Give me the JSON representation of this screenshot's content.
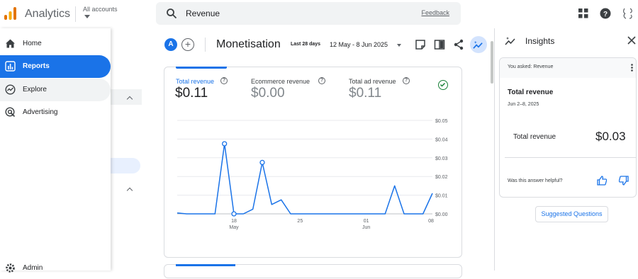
{
  "app": {
    "name": "Analytics",
    "accounts_label": "All accounts"
  },
  "search": {
    "value": "Revenue",
    "feedback": "Feedback"
  },
  "sidebar": {
    "items": [
      {
        "label": "Home",
        "icon": "home-icon"
      },
      {
        "label": "Reports",
        "icon": "bar-chart-icon"
      },
      {
        "label": "Explore",
        "icon": "explore-icon"
      },
      {
        "label": "Advertising",
        "icon": "advertising-icon"
      },
      {
        "label": "Admin",
        "icon": "gear-icon"
      }
    ]
  },
  "header": {
    "avatar": "A",
    "add": "+",
    "title": "Monetisation",
    "range_label": "Last 28 days",
    "range": "12 May - 8 Jun 2025"
  },
  "metrics": [
    {
      "label": "Total revenue",
      "value": "$0.11",
      "selected": true
    },
    {
      "label": "Ecommerce revenue",
      "value": "$0.00",
      "selected": false
    },
    {
      "label": "Total ad revenue",
      "value": "$0.11",
      "selected": false
    }
  ],
  "chart_data": {
    "type": "line",
    "x_tick_labels": [
      "18",
      "May",
      "25",
      "01",
      "Jun",
      "08"
    ],
    "y_tick_labels": [
      "$0.05",
      "$0.04",
      "$0.03",
      "$0.02",
      "$0.01",
      "$0.00"
    ],
    "ylim": [
      0,
      0.05
    ],
    "grid": true,
    "series": [
      {
        "x": [
          "12 May",
          "13 May",
          "14 May",
          "15 May",
          "16 May",
          "17 May",
          "18 May",
          "19 May",
          "20 May",
          "21 May",
          "22 May",
          "23 May",
          "24 May",
          "25 May",
          "26 May",
          "27 May",
          "28 May",
          "29 May",
          "30 May",
          "31 May",
          "1 Jun",
          "2 Jun",
          "3 Jun",
          "4 Jun",
          "5 Jun",
          "6 Jun",
          "7 Jun",
          "8 Jun"
        ],
        "values": [
          0.0005,
          0,
          0,
          0,
          0,
          0.0375,
          0,
          0,
          0.0025,
          0.0275,
          0.005,
          0.0075,
          0,
          0,
          0,
          0,
          0,
          0,
          0,
          0,
          0,
          0,
          0,
          0.015,
          0,
          0,
          0,
          0.011
        ],
        "markers": [
          5,
          6,
          9
        ],
        "color": "#1a73e8"
      }
    ]
  },
  "insights": {
    "title": "Insights",
    "asked": "You asked: Revenue",
    "heading": "Total revenue",
    "date": "Jun 2–8, 2025",
    "row_label": "Total revenue",
    "row_value": "$0.03",
    "helpful": "Was this answer helpful?",
    "suggested": "Suggested Questions"
  }
}
